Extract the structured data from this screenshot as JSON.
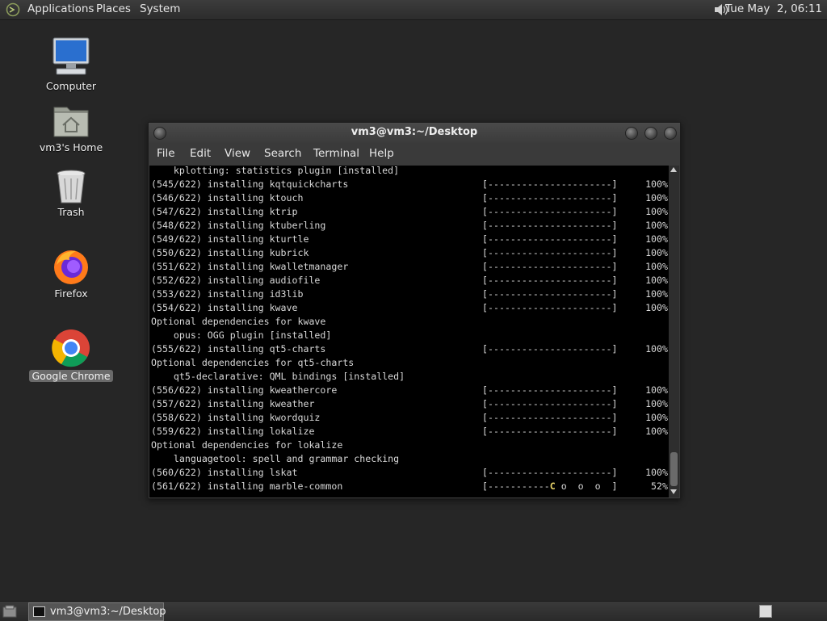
{
  "top_panel": {
    "menus": [
      "Applications",
      "Places",
      "System"
    ],
    "clock": "Tue May  2, 06:11"
  },
  "desktop_icons": [
    {
      "label": "Computer",
      "icon": "computer-icon"
    },
    {
      "label": "vm3's Home",
      "icon": "home-folder-icon"
    },
    {
      "label": "Trash",
      "icon": "trash-icon"
    },
    {
      "label": "Firefox",
      "icon": "firefox-icon"
    },
    {
      "label": "Google Chrome",
      "icon": "chrome-icon"
    }
  ],
  "window": {
    "title": "vm3@vm3:~/Desktop",
    "menu": [
      "File",
      "Edit",
      "View",
      "Search",
      "Terminal",
      "Help"
    ]
  },
  "terminal_lines": [
    {
      "text": "    kplotting: statistics plugin [installed]"
    },
    {
      "text": "(545/622) installing kqtquickcharts",
      "bar": "[----------------------]",
      "pct": "100%"
    },
    {
      "text": "(546/622) installing ktouch",
      "bar": "[----------------------]",
      "pct": "100%"
    },
    {
      "text": "(547/622) installing ktrip",
      "bar": "[----------------------]",
      "pct": "100%"
    },
    {
      "text": "(548/622) installing ktuberling",
      "bar": "[----------------------]",
      "pct": "100%"
    },
    {
      "text": "(549/622) installing kturtle",
      "bar": "[----------------------]",
      "pct": "100%"
    },
    {
      "text": "(550/622) installing kubrick",
      "bar": "[----------------------]",
      "pct": "100%"
    },
    {
      "text": "(551/622) installing kwalletmanager",
      "bar": "[----------------------]",
      "pct": "100%"
    },
    {
      "text": "(552/622) installing audiofile",
      "bar": "[----------------------]",
      "pct": "100%"
    },
    {
      "text": "(553/622) installing id3lib",
      "bar": "[----------------------]",
      "pct": "100%"
    },
    {
      "text": "(554/622) installing kwave",
      "bar": "[----------------------]",
      "pct": "100%"
    },
    {
      "text": "Optional dependencies for kwave"
    },
    {
      "text": "    opus: OGG plugin [installed]"
    },
    {
      "text": "(555/622) installing qt5-charts",
      "bar": "[----------------------]",
      "pct": "100%"
    },
    {
      "text": "Optional dependencies for qt5-charts"
    },
    {
      "text": "    qt5-declarative: QML bindings [installed]"
    },
    {
      "text": "(556/622) installing kweathercore",
      "bar": "[----------------------]",
      "pct": "100%"
    },
    {
      "text": "(557/622) installing kweather",
      "bar": "[----------------------]",
      "pct": "100%"
    },
    {
      "text": "(558/622) installing kwordquiz",
      "bar": "[----------------------]",
      "pct": "100%"
    },
    {
      "text": "(559/622) installing lokalize",
      "bar": "[----------------------]",
      "pct": "100%"
    },
    {
      "text": "Optional dependencies for lokalize"
    },
    {
      "text": "    languagetool: spell and grammar checking"
    },
    {
      "text": "(560/622) installing lskat",
      "bar": "[----------------------]",
      "pct": "100%"
    },
    {
      "text": "(561/622) installing marble-common",
      "bar_done": "[-----------",
      "bar_pac": "C",
      "bar_rest": " o  o  o  ]",
      "pct": "52%"
    }
  ],
  "taskbar": {
    "task_label": "vm3@vm3:~/Desktop"
  }
}
